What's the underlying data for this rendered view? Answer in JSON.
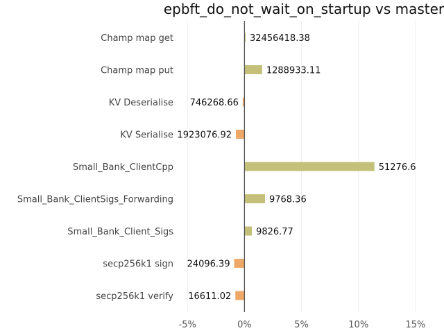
{
  "chart_data": {
    "type": "bar",
    "orientation": "horizontal",
    "title": "epbft_do_not_wait_on_startup vs master",
    "xlabel": "",
    "ylabel": "",
    "categories": [
      "Champ map get",
      "Champ map put",
      "KV Deserialise",
      "KV Serialise",
      "Small_Bank_ClientCpp",
      "Small_Bank_ClientSigs_Forwarding",
      "Small_Bank_Client_Sigs",
      "secp256k1 sign",
      "secp256k1 verify"
    ],
    "values": [
      0.1,
      1.55,
      -0.15,
      -0.75,
      11.4,
      1.8,
      0.65,
      -0.9,
      -0.8
    ],
    "value_labels": [
      "32456418.38",
      "1288933.11",
      "746268.66",
      "1923076.92",
      "51276.6",
      "9768.36",
      "9826.77",
      "24096.39",
      "16611.02"
    ],
    "value_unit": "%",
    "xlim": [
      -5.5,
      17.5
    ],
    "xticks": [
      -5,
      0,
      5,
      10,
      15
    ],
    "xtick_labels": [
      "-5%",
      "0%",
      "5%",
      "10%",
      "15%"
    ],
    "grid": "vertical",
    "legend": "none",
    "colors": {
      "positive": "#c4c07a",
      "negative": "#f0a868",
      "zero_line": "#555555",
      "grid": "#eeeeee"
    }
  }
}
